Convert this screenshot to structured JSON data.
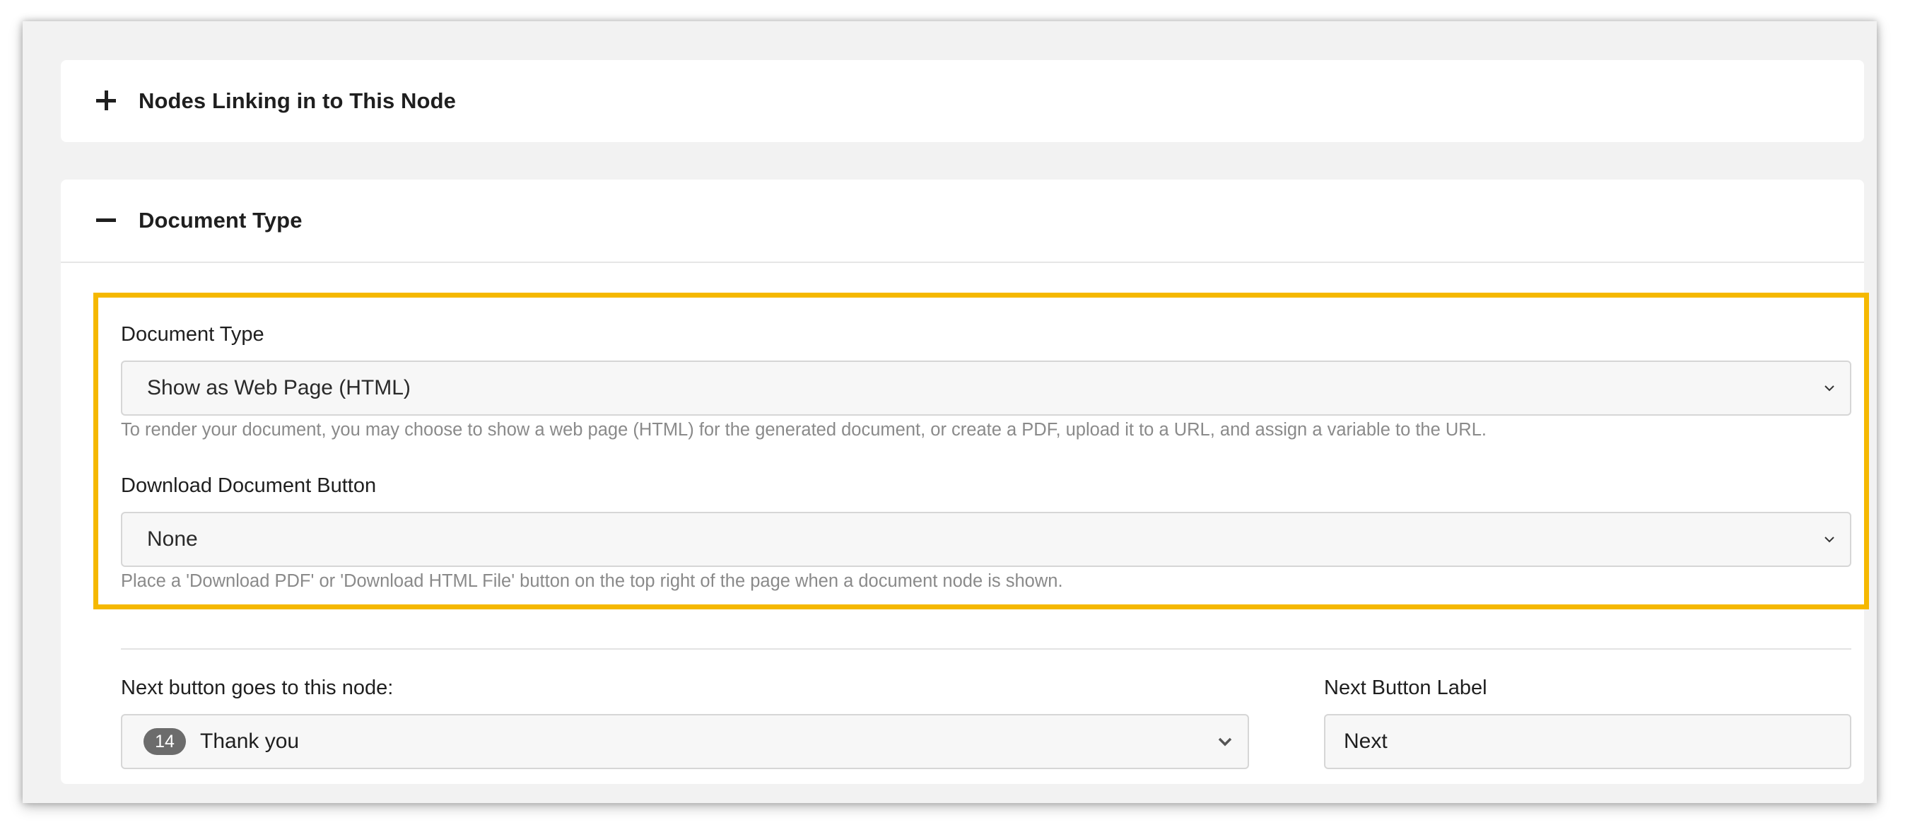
{
  "sections": {
    "nodes_linking": {
      "title": "Nodes Linking in to This Node",
      "toggle_icon": "plus-icon"
    },
    "document_type": {
      "title": "Document Type",
      "toggle_icon": "minus-icon"
    }
  },
  "fields": {
    "document_type": {
      "label": "Document Type",
      "selected": "Show as Web Page (HTML)",
      "help": "To render your document, you may choose to show a web page (HTML) for the generated document, or create a PDF, upload it to a URL, and assign a variable to the URL."
    },
    "download_button": {
      "label": "Download Document Button",
      "selected": "None",
      "help": "Place a 'Download PDF' or 'Download HTML File' button on the top right of the page when a document node is shown."
    },
    "next_node": {
      "label": "Next button goes to this node:",
      "badge": "14",
      "selected": "Thank you"
    },
    "next_label": {
      "label": "Next Button Label",
      "value": "Next"
    }
  },
  "colors": {
    "highlight": "#f5b800",
    "badge": "#6c6c6c"
  }
}
